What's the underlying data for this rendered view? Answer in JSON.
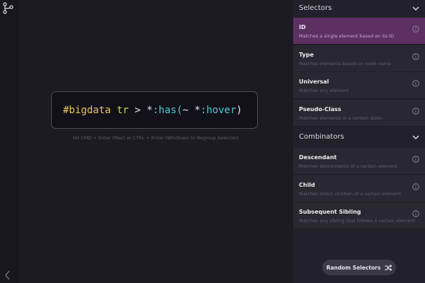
{
  "selector": {
    "tokens": [
      {
        "text": "#bigdata",
        "kind": "id"
      },
      {
        "text": "tr",
        "kind": "type"
      },
      {
        "text": ">",
        "kind": "plain"
      },
      {
        "text": "*",
        "kind": "plain"
      },
      {
        "text": ":has(",
        "kind": "pseudo"
      },
      {
        "text": "~",
        "kind": "plain"
      },
      {
        "text": "*",
        "kind": "plain"
      },
      {
        "text": ":hover",
        "kind": "pseudo"
      },
      {
        "text": ")",
        "kind": "plain"
      }
    ]
  },
  "hint": "Hit CMD + Enter (Mac) or CTRL + Enter (Windows) to Regroup Selectors",
  "sidebar": {
    "selectors_title": "Selectors",
    "selectors": [
      {
        "title": "ID",
        "desc": "Matches a single element based on its ID",
        "active": true
      },
      {
        "title": "Type",
        "desc": "Matches elements based on node name"
      },
      {
        "title": "Universal",
        "desc": "Matches any element"
      },
      {
        "title": "Pseudo-Class",
        "desc": "Matches elements in a certain state"
      }
    ],
    "combinators_title": "Combinators",
    "combinators": [
      {
        "title": "Descendant",
        "desc": "Matches descendants of a certain element"
      },
      {
        "title": "Child",
        "desc": "Matches direct children of a certain element"
      },
      {
        "title": "Subsequent Sibling",
        "desc": "Matches any sibling that follows a certain element"
      }
    ],
    "random_label": "Random Selectors"
  },
  "icons": {
    "logo": "branch-logo-icon",
    "collapse": "chevron-left-icon",
    "section_toggle": "chevron-down-icon",
    "info": "info-icon",
    "random": "shuffle-icon"
  },
  "colors": {
    "active_item": "#5e2f63",
    "id_token": "#e8c85a",
    "type_token": "#c6d84a",
    "pseudo_token": "#57c7d4"
  }
}
